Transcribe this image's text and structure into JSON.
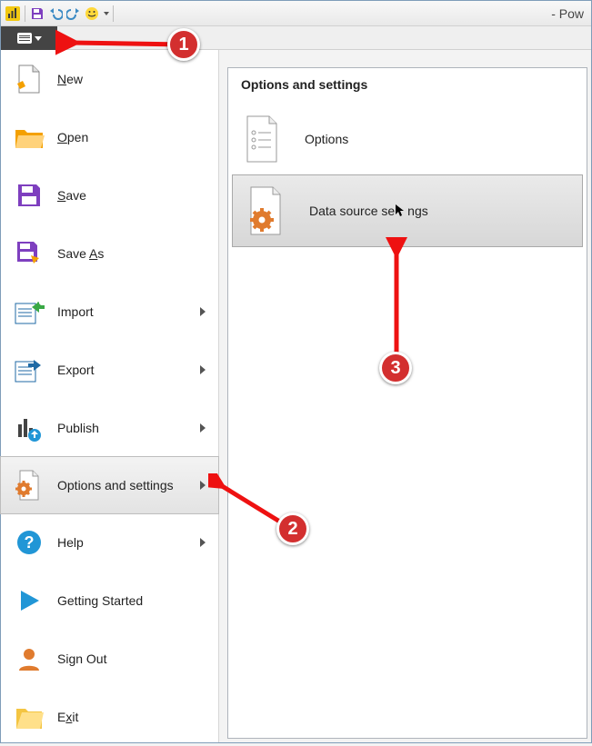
{
  "title_suffix": "- Pow",
  "menu": {
    "new": "New",
    "open": "Open",
    "save": "Save",
    "save_as_pre": "Save ",
    "save_as_accel": "A",
    "save_as_post": "s",
    "import": "Import",
    "export": "Export",
    "publish": "Publish",
    "options": "Options and settings",
    "help": "Help",
    "getting_started": "Getting Started",
    "sign_out": "Sign Out",
    "exit_accel": "x",
    "exit_pre": "E",
    "exit_post": "it"
  },
  "submenu": {
    "header": "Options and settings",
    "options": "Options",
    "dss_pre": "Data source se",
    "dss_post": "ngs"
  },
  "badges": {
    "b1": "1",
    "b2": "2",
    "b3": "3"
  }
}
